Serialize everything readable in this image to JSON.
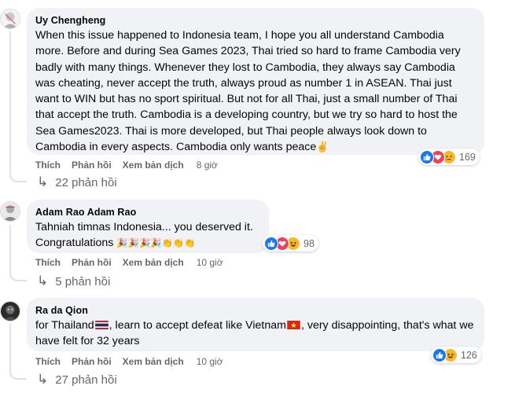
{
  "comments": [
    {
      "author": "Uy Chengheng",
      "text": "When this issue happened to Indonesia team, I hope you all understand Cambodia more. Before and during Sea Games 2023, Thai tried so hard to frame Cambodia very badly with many things. Whenever they lost to Cambodia, they always say Cambodia was cheating, never accept the truth, always proud as number 1 in ASEAN. Thai just want to WIN but has no sport spiritual. But not for all Thai, just a small number of Thai that accept the truth. Cambodia is a developing country, but we try so hard to host the Sea Games2023. Thai is more developed, but Thai people always look down to Cambodia in every aspects. Cambodia only wants peace",
      "trailing_emoji": "✌",
      "like_label": "Thích",
      "reply_label": "Phản hồi",
      "translate_label": "Xem bản dịch",
      "time": "8 giờ",
      "reaction_count": "169",
      "reaction_icons": [
        "like-icon",
        "love-icon",
        "sad-icon"
      ],
      "replies_label": "22 phản hồi"
    },
    {
      "author": "Adam Rao Adam Rao",
      "text_line1": "Tahniah timnas Indonesia... you deserved it.",
      "text_line2": "Congratulations",
      "emojis": "🎉🎉🎉🎉👏👏👏",
      "like_label": "Thích",
      "reply_label": "Phản hồi",
      "translate_label": "Xem bản dịch",
      "time": "10 giờ",
      "reaction_count": "98",
      "reaction_icons": [
        "like-icon",
        "love-icon",
        "haha-icon"
      ],
      "replies_label": "5 phản hồi"
    },
    {
      "author": "Ra da Qion",
      "text_part1": "for Thailand",
      "text_part2": ", learn to accept defeat like Vietnam",
      "text_part3": ", very disappointing, that's what we have felt for 32 years",
      "like_label": "Thích",
      "reply_label": "Phản hồi",
      "translate_label": "Xem bản dịch",
      "time": "10 giờ",
      "reaction_count": "126",
      "reaction_icons": [
        "like-icon",
        "haha-icon"
      ],
      "replies_label": "27 phản hồi"
    }
  ],
  "colors": {
    "bubble": "#f0f2f5",
    "meta_text": "#65676b",
    "like_blue": "#1877f2",
    "love_red": "#f33e58",
    "emoji_yellow": "#f7b928",
    "thread_line": "#dfe1e5"
  }
}
